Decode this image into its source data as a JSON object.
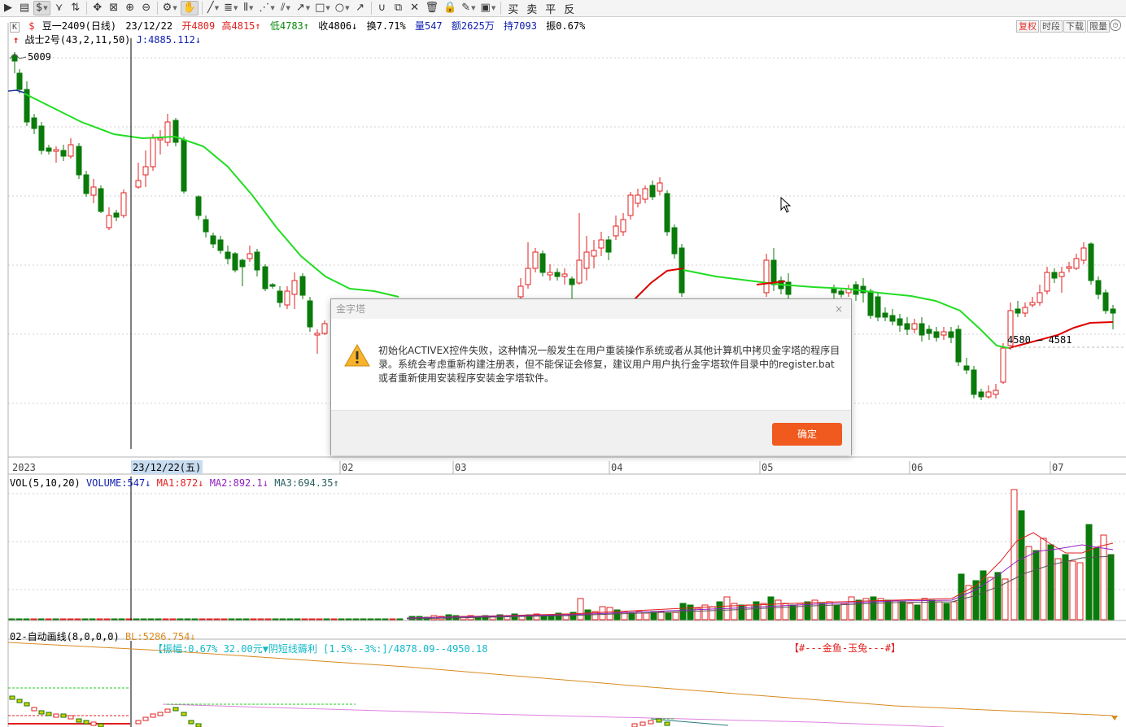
{
  "toolbar": {
    "sell_labels": [
      "买",
      "卖",
      "平",
      "反"
    ]
  },
  "quote": {
    "k_badge": "K",
    "dollar_glyph": "$",
    "symbol": "豆一2409(日线)",
    "date": "23/12/22",
    "open": "开4809",
    "high": "高4815",
    "low": "低4783",
    "close": "收4806",
    "turnover": "换7.71%",
    "volume": "量547",
    "amount": "额2625万",
    "position": "持7093",
    "amplitude": "振0.67%",
    "high_arrow": "↑",
    "low_arrow": "↑",
    "close_arrow": "↓"
  },
  "right_tabs": [
    "复权",
    "时段",
    "下载",
    "限量"
  ],
  "indicator": {
    "name": "战士2号(43,2,11,50)",
    "j_value": "J:4885.112",
    "j_arrow": "↓"
  },
  "price_labels": {
    "peak": "5009",
    "right_level": "4580 — 4581"
  },
  "x_axis": {
    "labels": [
      "2023",
      "02",
      "03",
      "04",
      "05",
      "06",
      "07"
    ],
    "cursor_date": "23/12/22(五)"
  },
  "volume_panel": {
    "title": "VOL(5,10,20)",
    "volume": "VOLUME:547",
    "volume_arrow": "↓",
    "ma1": "MA1:872",
    "ma1_arrow": "↓",
    "ma2": "MA2:892.1",
    "ma2_arrow": "↓",
    "ma3": "MA3:694.35",
    "ma3_arrow": "↑"
  },
  "auto_panel": {
    "title": "02-自动画线(8,0,0,0)",
    "bl": "BL:5286.754",
    "bl_arrow": "↓",
    "info": "【振幅:0.67% 32.00元▼阴短线薅利 [1.5%--3%:]/4878.09--4950.18",
    "tag": "【#---金鱼-玉兔---#】"
  },
  "dialog": {
    "title": "金字塔",
    "close": "×",
    "message": "初始化ACTIVEX控件失败，这种情况一般发生在用户重装操作系统或者从其他计算机中拷贝金字塔的程序目录。系统会考虑重新构建注册表，但不能保证会修复，建议用户用户执行金字塔软件目录中的register.bat或者重新使用安装程序安装金字塔软件。",
    "ok_label": "确定"
  },
  "colors": {
    "up": "#e02020",
    "down": "#0a7a0a",
    "ma_green": "#22dd22",
    "ma_red": "#dd0000",
    "dialog_button": "#f05a1e"
  }
}
